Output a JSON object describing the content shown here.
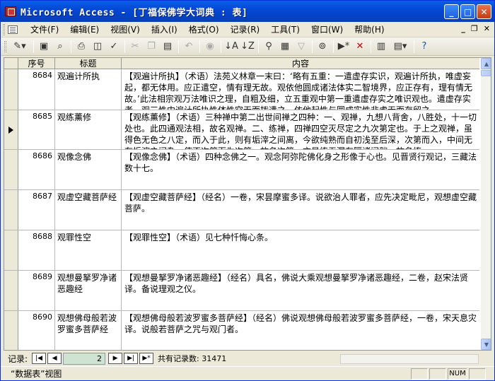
{
  "window": {
    "title": "Microsoft Access - [丁福保佛学大词典 : 表]",
    "btn_min": "_",
    "btn_max": "□",
    "btn_close": "✕"
  },
  "menu": [
    "文件(F)",
    "编辑(E)",
    "视图(V)",
    "插入(I)",
    "格式(O)",
    "记录(R)",
    "工具(T)",
    "窗口(W)",
    "帮助(H)"
  ],
  "mdi": {
    "min": "_",
    "restore": "❐",
    "close": "✕"
  },
  "toolbar": [
    "design-view",
    "save",
    "search-file",
    "print",
    "print-preview",
    "spelling",
    "cut",
    "copy",
    "paste",
    "undo",
    "insert-hyperlink",
    "sort-asc",
    "sort-desc",
    "filter-by-selection",
    "filter-by-form",
    "apply-filter",
    "find",
    "new-record",
    "delete-record",
    "properties",
    "database-window",
    "new-object",
    "help"
  ],
  "columns": [
    "序号",
    "标题",
    "内容"
  ],
  "rows": [
    {
      "id": "8684",
      "title": "观遍计所执",
      "content": "【观遍计所执】（术语）法苑义林章一末曰：‘略有五重：一遣虚存实识，观遍计所执，唯虚妄起，都无体用。应正遣空，情有理无故。观依他圆成诸法体实二智境界，应正存有，理有情无故。’此法相宗观万法唯识之理，自粗及细，立五重观中第一重遣虚存实之唯识观也。遣虚存实者，观三性中遍计所执性体性空无而拨遣之，依他起性与圆成实性非虚无而存留之"
    },
    {
      "id": "8685",
      "title": "观练薰修",
      "content": "【观练薰修】（术语）三种禅中第二出世间禅之四种：一、观禅，九想八背舍，八胜处，十一切处也。此四通观法相，故名观禅。二、练禅，四禅四空灭尽定之九次第定也。于上之观禅，虽得色无色之八定，而入于此，则有垢滓之间离，今欲纯熟而自初浅至后深，次第而入，中间无有垢滓之间杂，使不次第而为次第，故名次第。亦是练无漏有隔诸间秽，故名练"
    },
    {
      "id": "8686",
      "title": "观像念佛",
      "content": "【观像念佛】（术语）四种念佛之一。观念阿弥陀佛化身之形像于心也。见晋贤行观记，三藏法数十七。"
    },
    {
      "id": "8687",
      "title": "观虚空藏菩萨经",
      "content": "【观虚空藏菩萨经】（经名）一卷，宋昙摩蜜多译。说欲治人罪者，应先决定毗尼，观想虚空藏菩萨。"
    },
    {
      "id": "8688",
      "title": "观罪性空",
      "content": "【观罪性空】（术语）见七种忏悔心条。"
    },
    {
      "id": "8689",
      "title": "观想曼拏罗净诸恶趣经",
      "content": "【观想曼拏罗净诸恶趣经】（经名）具名，佛说大乘观想曼拏罗净诸恶趣经，二卷，赵宋法贤译。备说理观之仪。"
    },
    {
      "id": "8690",
      "title": "观想佛母般若波罗蜜多菩萨经",
      "content": "【观想佛母般若波罗蜜多菩萨经】（经名）佛说观想佛母般若波罗蜜多菩萨经，一卷，宋天息灾译。说般若菩萨之咒与观门者。"
    }
  ],
  "current_row": 1,
  "nav": {
    "label": "记录:",
    "current": "2",
    "first": "|◀",
    "prev": "◀",
    "next": "▶",
    "last": "▶|",
    "new": "▶*",
    "total_label": "共有记录数: 31471"
  },
  "status": {
    "text": "“数据表”视图",
    "num": "NUM"
  }
}
